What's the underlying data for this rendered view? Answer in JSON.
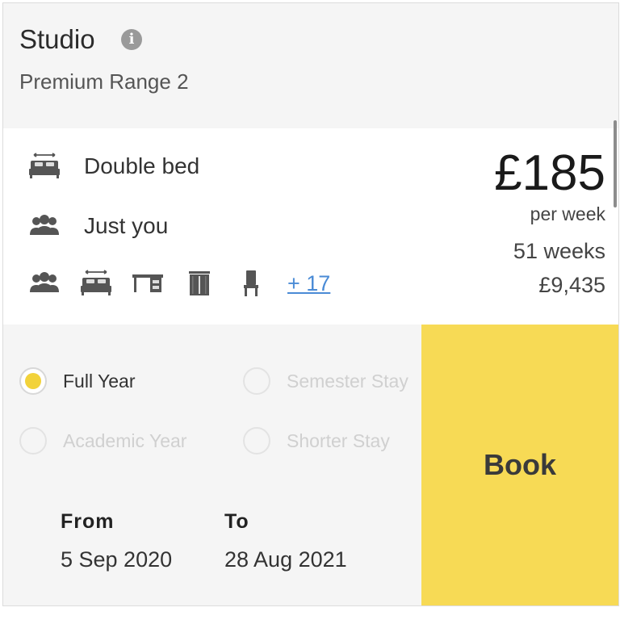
{
  "room": {
    "title": "Studio",
    "info_icon": "i",
    "subtitle": "Premium Range 2"
  },
  "features": [
    {
      "icon": "bed-icon",
      "label": "Double bed"
    },
    {
      "icon": "people-icon",
      "label": "Just you"
    }
  ],
  "amenities": {
    "icons": [
      "people-icon",
      "bed-icon",
      "desk-icon",
      "wardrobe-icon",
      "chair-icon"
    ],
    "more_label": "+ 17"
  },
  "pricing": {
    "price": "£185",
    "period": "per week",
    "duration": "51 weeks",
    "total": "£9,435"
  },
  "tenancy_options": [
    {
      "label": "Full Year",
      "selected": true
    },
    {
      "label": "Semester Stay",
      "selected": false
    },
    {
      "label": "Academic Year",
      "selected": false
    },
    {
      "label": "Shorter Stay",
      "selected": false
    }
  ],
  "dates": {
    "from_label": "From",
    "from_value": "5 Sep 2020",
    "to_label": "To",
    "to_value": "28 Aug 2021"
  },
  "book_label": "Book",
  "colors": {
    "accent": "#f7da55",
    "link": "#4a8bd6",
    "header_bg": "#f5f5f5"
  }
}
